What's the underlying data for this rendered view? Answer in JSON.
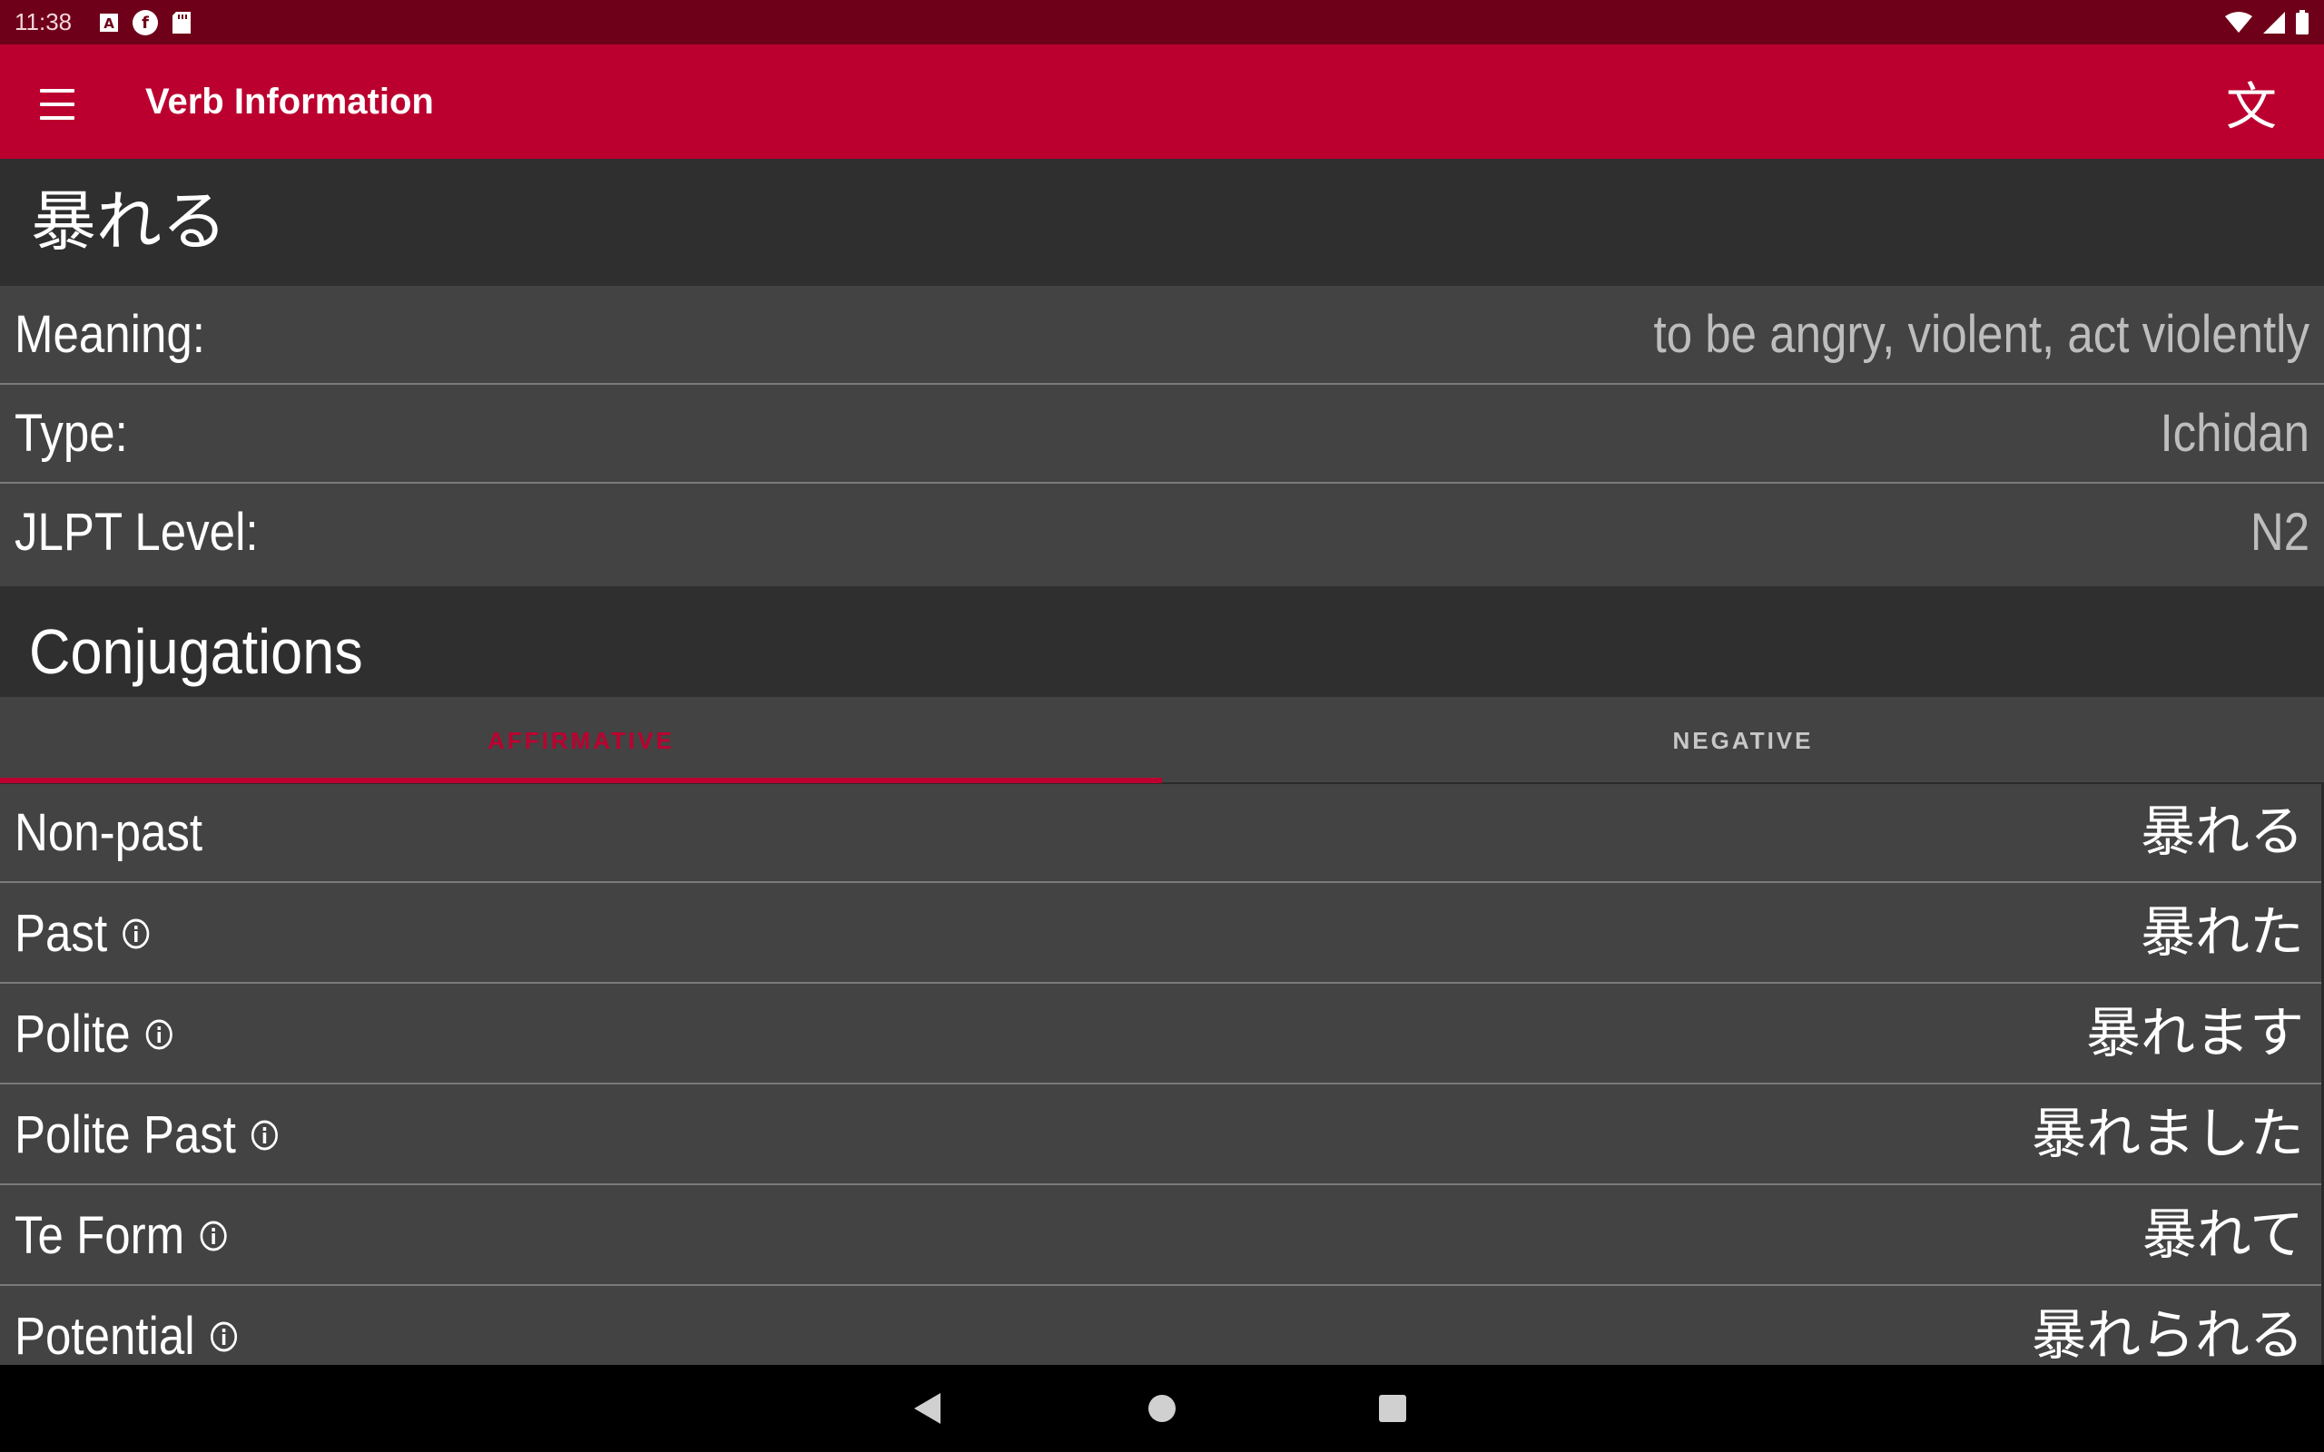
{
  "status": {
    "time": "11:38",
    "notif_icons": [
      "a-icon",
      "f-icon",
      "sd-card-icon"
    ],
    "right_icons": [
      "wifi-icon",
      "signal-icon",
      "battery-icon"
    ]
  },
  "app_bar": {
    "title": "Verb Information",
    "menu_icon": "menu-icon",
    "action_icon": "translate-icon",
    "action_glyph": "文"
  },
  "verb": {
    "kanji": "暴れる",
    "info": [
      {
        "label": "Meaning:",
        "value": "to be angry, violent, act violently"
      },
      {
        "label": "Type:",
        "value": "Ichidan"
      },
      {
        "label": "JLPT Level:",
        "value": "N2"
      }
    ]
  },
  "conjugations": {
    "title": "Conjugations",
    "tabs": [
      {
        "label": "AFFIRMATIVE",
        "selected": true
      },
      {
        "label": "NEGATIVE",
        "selected": false
      }
    ],
    "rows": [
      {
        "label": "Non-past",
        "value": "暴れる",
        "has_info": false
      },
      {
        "label": "Past",
        "value": "暴れた",
        "has_info": true
      },
      {
        "label": "Polite",
        "value": "暴れます",
        "has_info": true
      },
      {
        "label": "Polite Past",
        "value": "暴れました",
        "has_info": true
      },
      {
        "label": "Te Form",
        "value": "暴れて",
        "has_info": true
      },
      {
        "label": "Potential",
        "value": "暴れられる",
        "has_info": true
      }
    ]
  },
  "colors": {
    "primary": "#bb002f",
    "status_bar": "#6f0019",
    "row_bg": "#434343",
    "header_bg": "#2f2f2f",
    "value_gray": "#bdbdbd"
  }
}
